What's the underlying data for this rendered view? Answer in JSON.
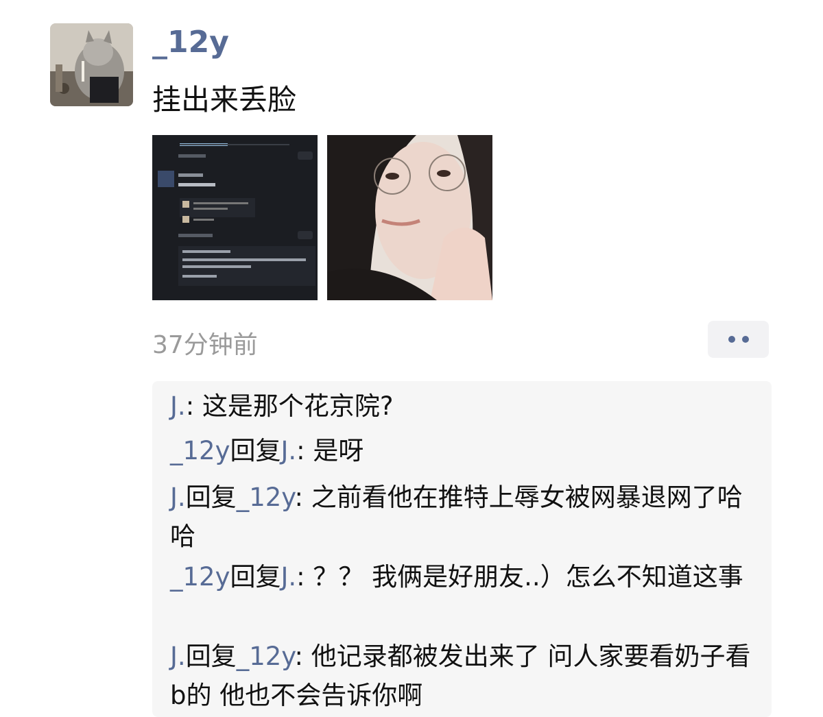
{
  "post": {
    "username": "_12y",
    "text": "挂出来丢脸",
    "timestamp": "37分钟前",
    "images": [
      {
        "icon": "screenshot-image"
      },
      {
        "icon": "selfie-photo"
      }
    ]
  },
  "comments": [
    {
      "author": "J.",
      "reply_word": "",
      "reply_to": "",
      "text": "这是那个花京院?"
    },
    {
      "author": "_12y",
      "reply_word": "回复",
      "reply_to": "J.",
      "text": "是呀"
    },
    {
      "author": "J.",
      "reply_word": "回复",
      "reply_to": "_12y",
      "text": "之前看他在推特上辱女被网暴退网了哈哈"
    },
    {
      "author": "_12y",
      "reply_word": "回复",
      "reply_to": "J.",
      "text": "？？ 我俩是好朋友..）怎么不知道这事"
    },
    {
      "author": "J.",
      "reply_word": "回复",
      "reply_to": "_12y",
      "text": "他记录都被发出来了 问人家要看奶子看b的 他也不会告诉你啊"
    }
  ],
  "colors": {
    "name_link": "#576b95",
    "comment_bg": "#f6f6f6",
    "timestamp": "#9a9a9a"
  }
}
